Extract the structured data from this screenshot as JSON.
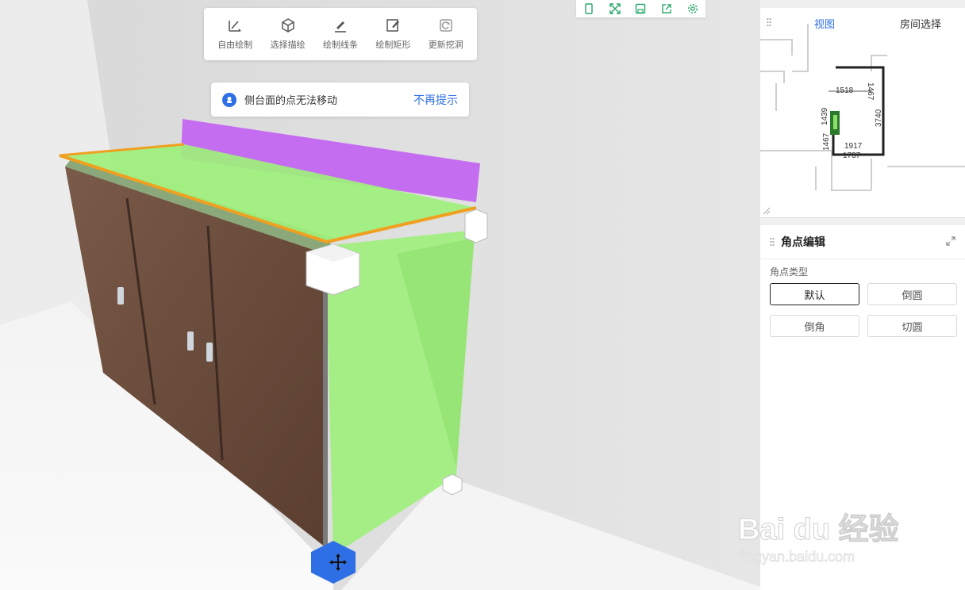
{
  "toolbar": {
    "tools": [
      {
        "label": "自由绘制",
        "icon": "free-draw-icon"
      },
      {
        "label": "选择描绘",
        "icon": "cube-select-icon"
      },
      {
        "label": "绘制线条",
        "icon": "pen-line-icon"
      },
      {
        "label": "绘制矩形",
        "icon": "rect-edit-icon"
      },
      {
        "label": "更新挖洞",
        "icon": "refresh-hole-icon"
      }
    ]
  },
  "hint": {
    "text": "侧台面的点无法移动",
    "action": "不再提示"
  },
  "iconbar": {
    "icons": [
      "phone-icon",
      "fullscreen-icon",
      "save-icon",
      "share-icon",
      "settings-icon"
    ],
    "accent": "#2aa86a"
  },
  "minimap": {
    "tabs": [
      "视图",
      "房间选择"
    ],
    "dims": [
      "1518",
      "1467",
      "1439",
      "3740",
      "1917",
      "1737",
      "1467"
    ]
  },
  "corner_panel": {
    "title": "角点编辑",
    "type_label": "角点类型",
    "options": [
      "默认",
      "倒圆",
      "倒角",
      "切圆"
    ],
    "selected": "默认"
  },
  "watermark": {
    "brand": "Bai du 经验",
    "url": "jingyan.baidu.com"
  },
  "colors": {
    "accent": "#2f6fe6",
    "countertop": "#9ef07c",
    "backsplash": "#c56df0",
    "edge": "#f0a020",
    "cabinet": "#6b4a3a"
  }
}
